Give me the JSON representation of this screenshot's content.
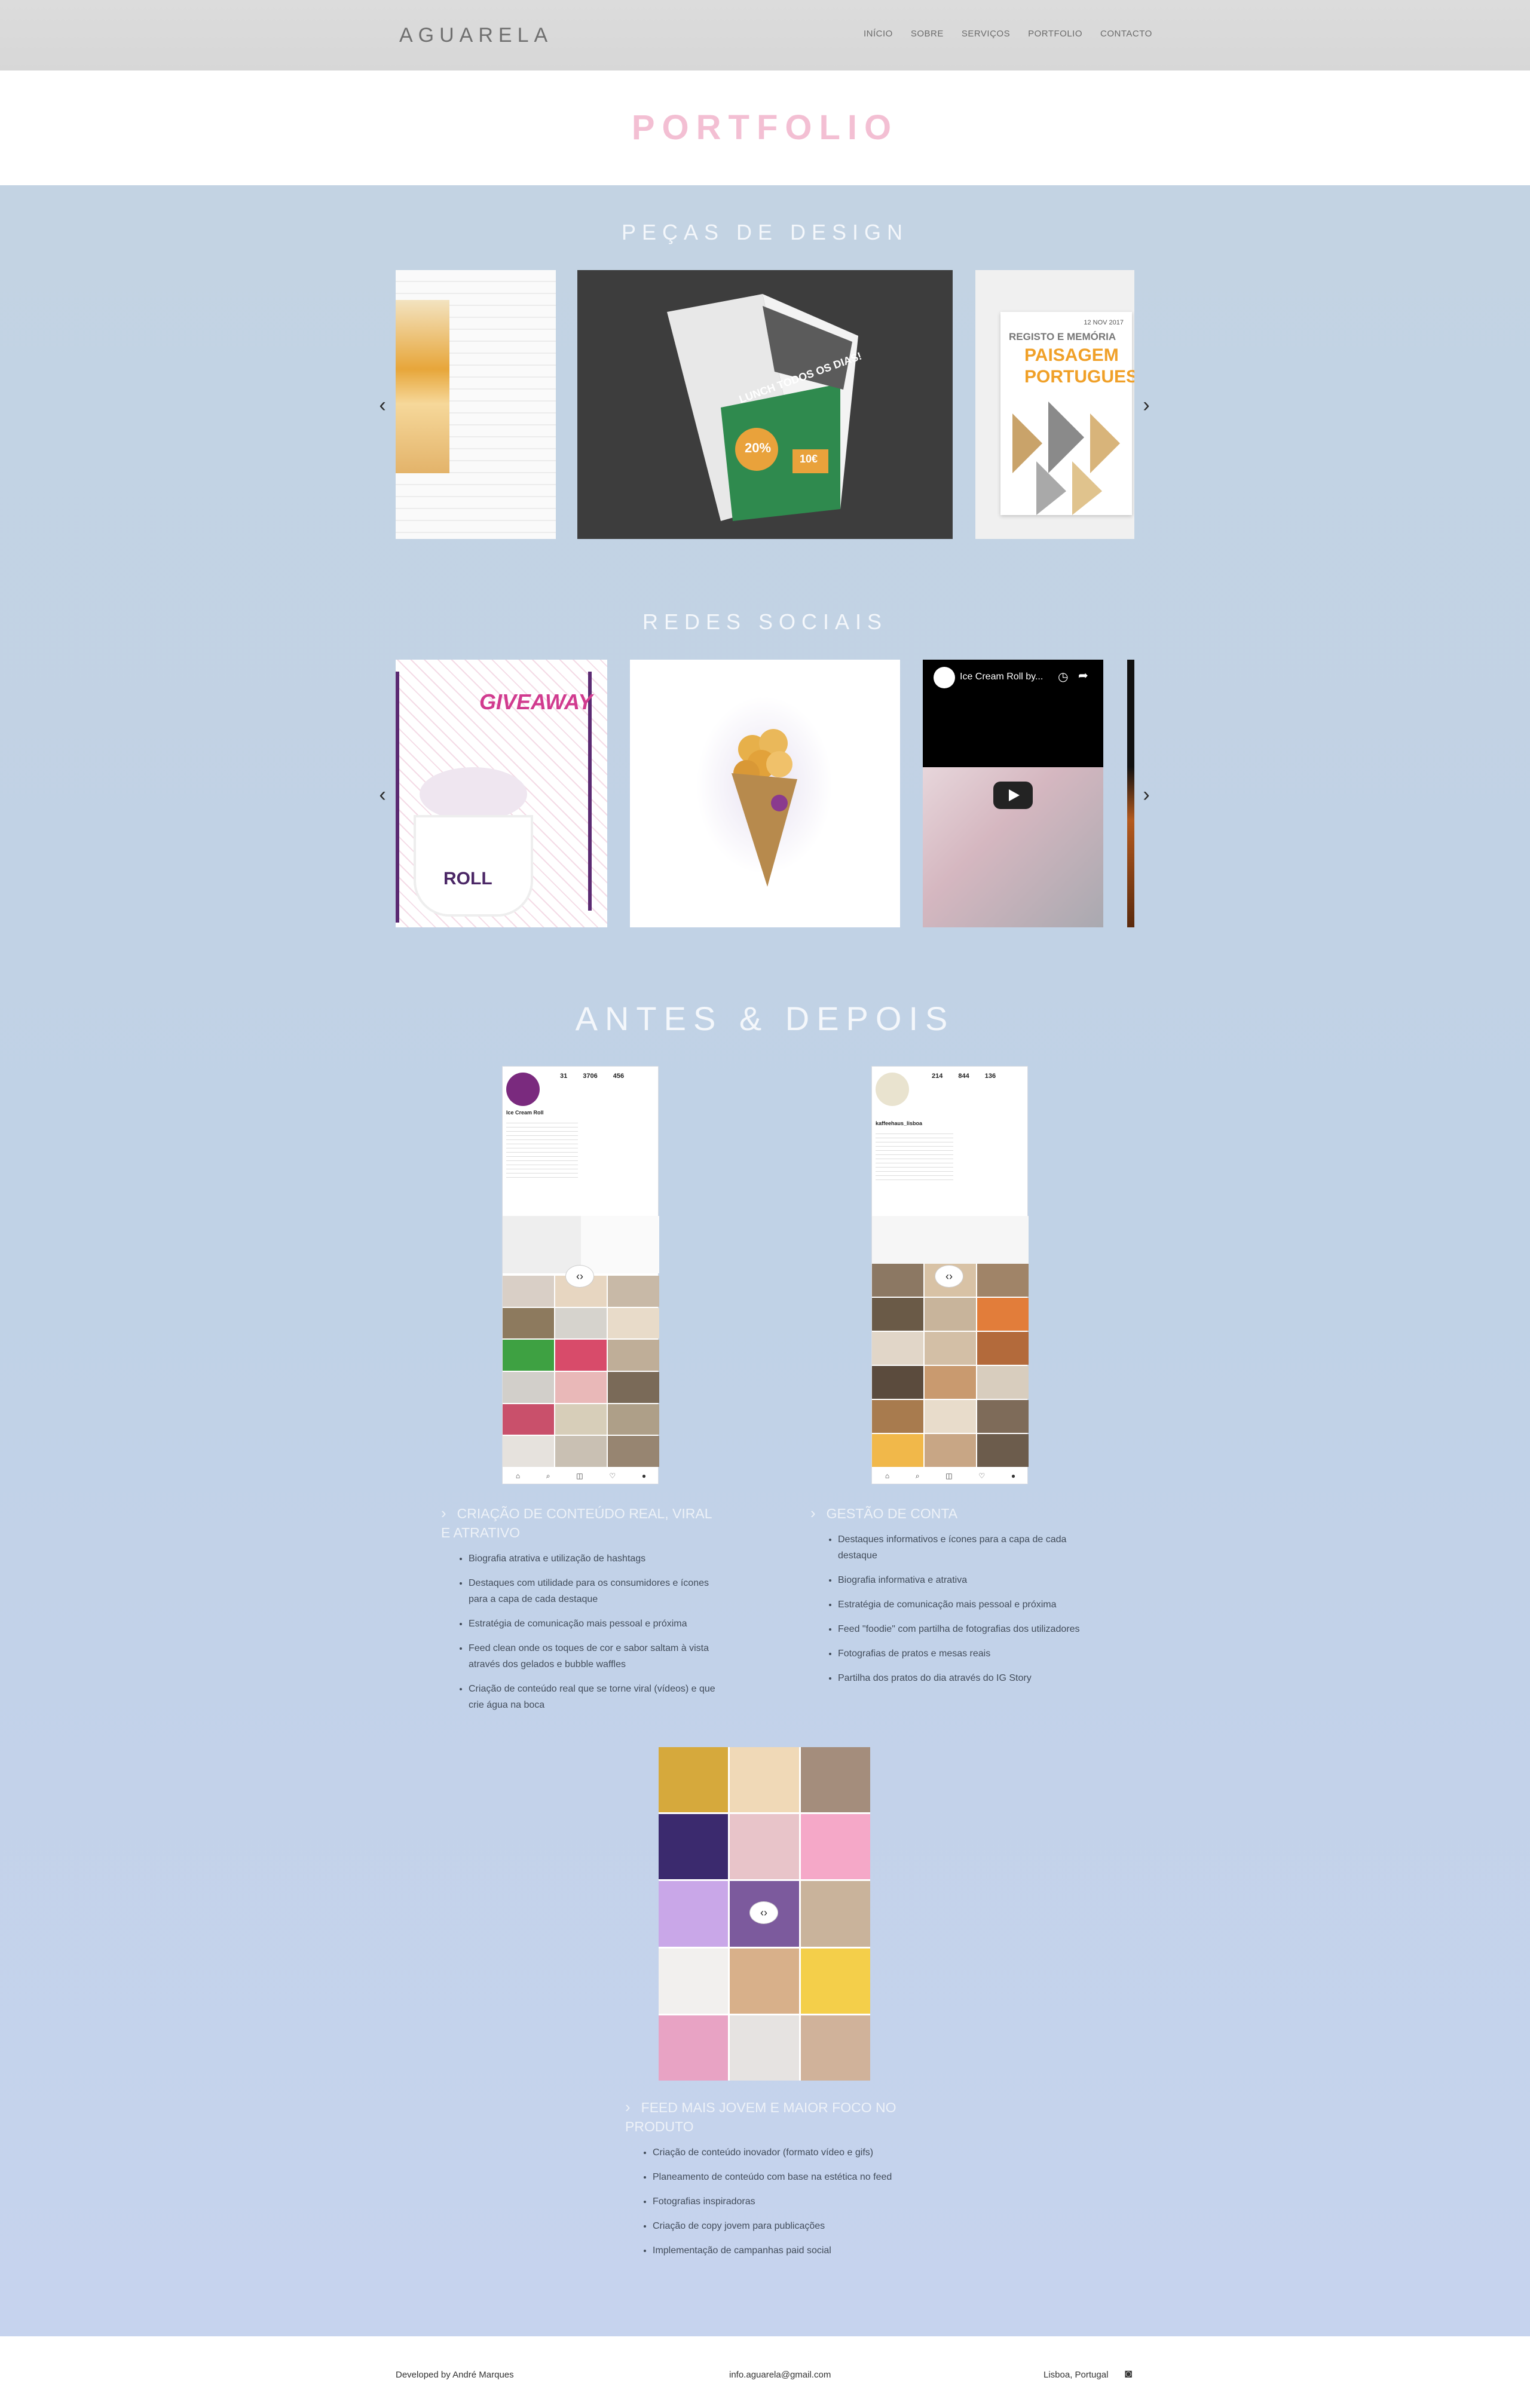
{
  "header": {
    "logo": "AGUARELA",
    "nav": [
      "INÍCIO",
      "SOBRE",
      "SERVIÇOS",
      "PORTFOLIO",
      "CONTACTO"
    ]
  },
  "page_title": "PORTFOLIO",
  "sections": {
    "design": {
      "title": "PEÇAS DE DESIGN"
    },
    "social": {
      "title": "REDES SOCIAIS",
      "video_title": "Ice Cream Roll by...",
      "giveaway": "GIVEAWAY"
    },
    "before_after": {
      "title": "ANTES & DEPOIS"
    }
  },
  "poster": {
    "date": "12 NOV 2017",
    "line1": "REGISTO E MEMÓRIA",
    "line2": "PAISAGEM",
    "line3": "PORTUGUESA"
  },
  "magazine": {
    "headline": "LUNCH TODOS OS DIAS!",
    "badge": "20%",
    "price": "10€"
  },
  "case1": {
    "heading": "CRIAÇÃO DE CONTEÚDO REAL, VIRAL E ATRATIVO",
    "items": [
      "Biografia atrativa e utilização de hashtags",
      "Destaques com utilidade para os consumidores e ícones para a capa de cada destaque",
      "Estratégia de comunicação mais pessoal e próxima",
      "Feed clean onde os toques de cor e sabor saltam à vista através dos gelados e bubble waffles",
      "Criação de conteúdo real que se torne viral (vídeos) e que crie água na boca"
    ]
  },
  "case2": {
    "heading": "GESTÃO DE CONTA",
    "items": [
      "Destaques informativos e ícones para a capa de cada destaque",
      "Biografia informativa e atrativa",
      "Estratégia de comunicação mais pessoal e próxima",
      "Feed \"foodie\" com partilha de fotografias dos utilizadores",
      "Fotografias de pratos e mesas reais",
      "Partilha dos pratos do dia através do IG Story"
    ]
  },
  "case3": {
    "heading": "FEED MAIS JOVEM E MAIOR FOCO NO PRODUTO",
    "items": [
      "Criação de conteúdo inovador (formato vídeo e gifs)",
      "Planeamento de conteúdo com base na estética no feed",
      "Fotografias inspiradoras",
      "Criação de copy jovem para publicações",
      "Implementação de campanhas paid social"
    ]
  },
  "phone1": {
    "handle": "Ice Cream Roll",
    "posts": "31",
    "followers": "3706",
    "following": "456"
  },
  "phone2": {
    "handle": "kaffeehaus_lisboa",
    "posts": "214",
    "followers": "844",
    "following": "136"
  },
  "footer": {
    "dev": "Developed by André Marques",
    "email": "info.aguarela@gmail.com",
    "location": "Lisboa, Portugal"
  },
  "colors": {
    "title_pink": "#f3bfd3",
    "bg_blue": "#c3d3e3",
    "header_grey": "#dcdcdc"
  }
}
